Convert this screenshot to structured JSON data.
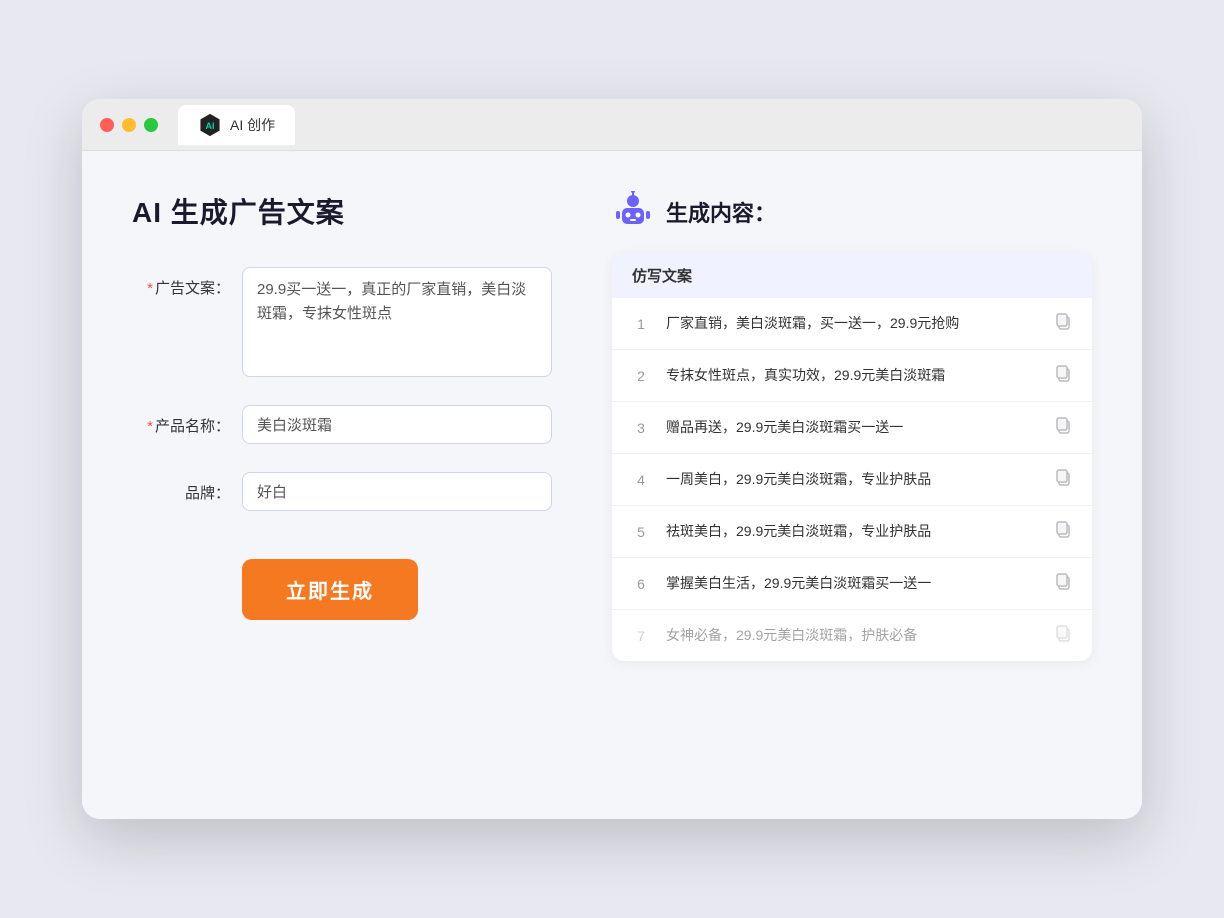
{
  "browser": {
    "tab_label": "AI 创作"
  },
  "page": {
    "title": "AI 生成广告文案",
    "right_title": "生成内容："
  },
  "form": {
    "ad_copy_label": "广告文案：",
    "ad_copy_value": "29.9买一送一，真正的厂家直销，美白淡斑霜，专抹女性斑点",
    "product_name_label": "产品名称：",
    "product_name_value": "美白淡斑霜",
    "brand_label": "品牌：",
    "brand_value": "好白",
    "generate_btn": "立即生成"
  },
  "results": {
    "column_header": "仿写文案",
    "items": [
      {
        "num": "1",
        "text": "厂家直销，美白淡斑霜，买一送一，29.9元抢购",
        "faded": false
      },
      {
        "num": "2",
        "text": "专抹女性斑点，真实功效，29.9元美白淡斑霜",
        "faded": false
      },
      {
        "num": "3",
        "text": "赠品再送，29.9元美白淡斑霜买一送一",
        "faded": false
      },
      {
        "num": "4",
        "text": "一周美白，29.9元美白淡斑霜，专业护肤品",
        "faded": false
      },
      {
        "num": "5",
        "text": "祛斑美白，29.9元美白淡斑霜，专业护肤品",
        "faded": false
      },
      {
        "num": "6",
        "text": "掌握美白生活，29.9元美白淡斑霜买一送一",
        "faded": false
      },
      {
        "num": "7",
        "text": "女神必备，29.9元美白淡斑霜，护肤必备",
        "faded": true
      }
    ]
  }
}
